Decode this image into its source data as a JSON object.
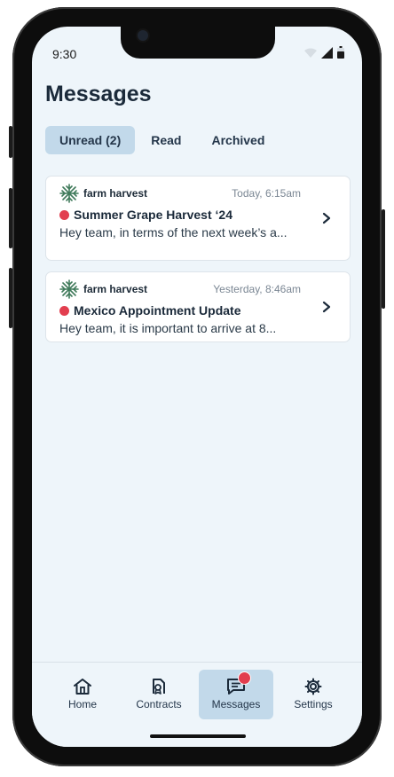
{
  "status": {
    "time": "9:30"
  },
  "header": {
    "title": "Messages"
  },
  "tabs": [
    {
      "label": "Unread (2)",
      "active": true
    },
    {
      "label": "Read",
      "active": false
    },
    {
      "label": "Archived",
      "active": false
    }
  ],
  "messages": [
    {
      "brand": "farm harvest",
      "time": "Today, 6:15am",
      "subject": "Summer Grape Harvest ‘24",
      "preview": "Hey team, in terms of the next week’s a..."
    },
    {
      "brand": "farm harvest",
      "time": "Yesterday, 8:46am",
      "subject": "Mexico Appointment Update",
      "preview": "Hey team, it is important to arrive at 8..."
    }
  ],
  "nav": {
    "items": [
      {
        "label": "Home",
        "icon": "home-icon"
      },
      {
        "label": "Contracts",
        "icon": "contract-icon"
      },
      {
        "label": "Messages",
        "icon": "message-icon",
        "active": true,
        "badge": true
      },
      {
        "label": "Settings",
        "icon": "gear-icon"
      }
    ]
  },
  "colors": {
    "accent": "#c2d9ea",
    "badge": "#e23e4f",
    "brand_green": "#3f7a5a",
    "background": "#eef5fa"
  }
}
